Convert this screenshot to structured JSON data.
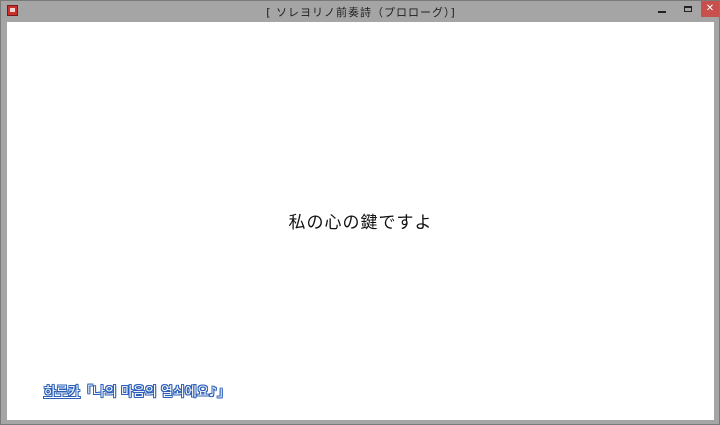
{
  "window": {
    "title": "[ ソレヨリノ前奏詩（プロローグ）]",
    "controls": {
      "minimize_icon": "minimize-icon",
      "maximize_icon": "maximize-icon",
      "close_icon": "close-icon",
      "close_glyph": "✕"
    },
    "colors": {
      "frame": "#a5a5a5",
      "close": "#c7504c",
      "app_icon": "#c8302c"
    }
  },
  "scene": {
    "main_text": "私の心の鍵ですよ",
    "subtitle": {
      "speaker": "하루카",
      "line": "「나의 마음의 열쇠에요♪」",
      "outline_color": "#2b5fb8"
    }
  }
}
